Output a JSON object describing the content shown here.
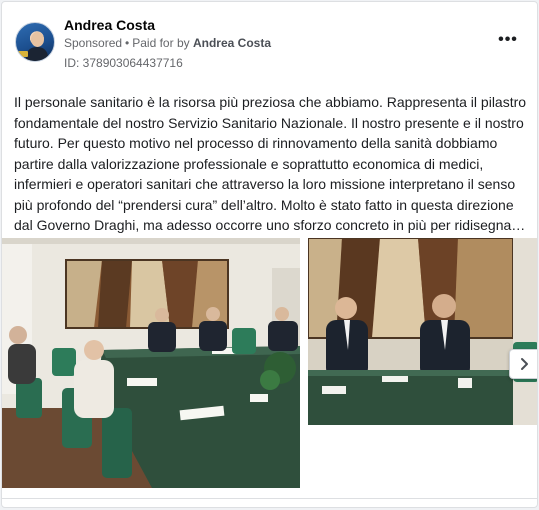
{
  "post": {
    "author": "Andrea Costa",
    "sponsored_label": "Sponsored",
    "separator": "•",
    "paid_for_prefix": "Paid for by",
    "paid_for_name": "Andrea Costa",
    "ad_id": "ID: 378903064437716",
    "more_label": "•••",
    "text": "Il personale sanitario è la risorsa più preziosa che abbiamo. Rappresenta il pilastro fondamentale del nostro Servizio Sanitario Nazionale. Il nostro presente e il nostro futuro. Per questo motivo nel processo di rinnovamento della sanità dobbiamo partire dalla valorizzazione professionale e soprattutto economica di medici, infermieri e operatori sanitari che attraverso la loro missione interpretano il senso più profondo del “prendersi cura” dell’altro. Molto è stato fatto in questa direzione dal Governo Draghi, ma adesso occorre uno sforzo concreto in più per ridisegnare il futuro del nostro sistema sanitario."
  },
  "carousel": {
    "photos": [
      {
        "name": "meeting-room-photo"
      },
      {
        "name": "speakers-photo"
      }
    ],
    "next_icon": "chevron-right-icon"
  },
  "colors": {
    "text_primary": "#050505",
    "text_secondary": "#65676b",
    "card_border": "#dddfe2",
    "table_green": "#2f4f3c"
  }
}
